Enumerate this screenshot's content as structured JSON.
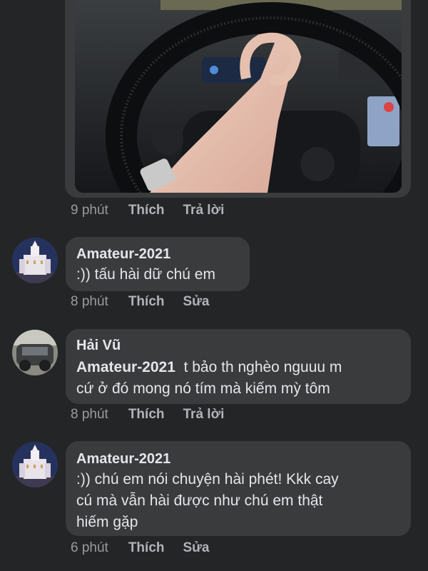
{
  "comments": [
    {
      "time": "9 phút",
      "like": "Thích",
      "action": "Trả lời"
    },
    {
      "author": "Amateur-2021",
      "text": ":)) tấu hài dữ chú em",
      "time": "8 phút",
      "like": "Thích",
      "action": "Sửa"
    },
    {
      "author": "Hải Vũ",
      "mention": "Amateur-2021",
      "text_line1": "t bảo th nghèo nguuu m",
      "text_line2": "cứ ở đó mong nó tím mà kiếm mỳ tôm",
      "time": "8 phút",
      "like": "Thích",
      "action": "Trả lời"
    },
    {
      "author": "Amateur-2021",
      "lines": [
        ":)) chú em nói chuyện hài phét! Kkk cay",
        "cú mà vẫn hài được như chú em thật",
        "hiếm gặp"
      ],
      "time": "6 phút",
      "like": "Thích",
      "action": "Sửa"
    }
  ]
}
